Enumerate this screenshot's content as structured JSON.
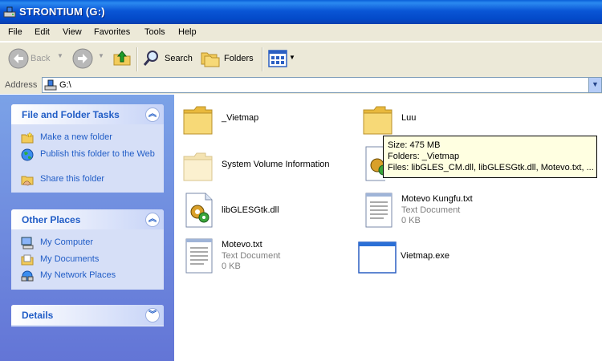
{
  "window": {
    "title": "STRONTIUM (G:)"
  },
  "menu": [
    "File",
    "Edit",
    "View",
    "Favorites",
    "Tools",
    "Help"
  ],
  "toolbar": {
    "back": "Back",
    "search": "Search",
    "folders": "Folders"
  },
  "address": {
    "label": "Address",
    "path": "G:\\"
  },
  "left_pane": {
    "file_tasks": {
      "title": "File and Folder Tasks",
      "items": [
        "Make a new folder",
        "Publish this folder to the Web",
        "Share this folder"
      ]
    },
    "other_places": {
      "title": "Other Places",
      "items": [
        "My Computer",
        "My Documents",
        "My Network Places"
      ]
    },
    "details": {
      "title": "Details"
    }
  },
  "files": [
    {
      "name": "_Vietmap",
      "type": "folder"
    },
    {
      "name": "Luu",
      "type": "folder"
    },
    {
      "name": "System Volume Information",
      "type": "folder-hidden"
    },
    {
      "name": "libGLESGtk.dll",
      "type": "dll"
    },
    {
      "name": "Motevo Kungfu.txt",
      "type": "txt",
      "kind": "Text Document",
      "size": "0 KB"
    },
    {
      "name": "Motevo.txt",
      "type": "txt",
      "kind": "Text Document",
      "size": "0 KB"
    },
    {
      "name": "Vietmap.exe",
      "type": "exe"
    }
  ],
  "tooltip": {
    "size": "Size: 475 MB",
    "folders": "Folders: _Vietmap",
    "files": "Files: libGLES_CM.dll, libGLESGtk.dll, Motevo.txt, ..."
  }
}
